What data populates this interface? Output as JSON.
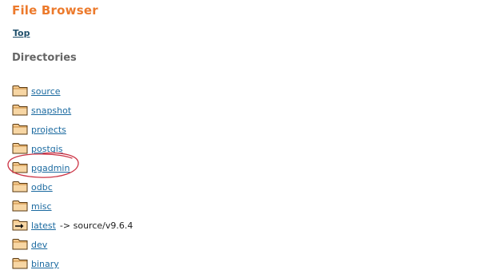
{
  "header": {
    "title": "File Browser",
    "top_link": "Top"
  },
  "directories_heading": "Directories",
  "colors": {
    "title": "#ec7a2c",
    "link": "#1b6aa0",
    "heading": "#666666",
    "annotation": "#cc3344"
  },
  "directories": [
    {
      "name": "source",
      "icon": "folder-icon"
    },
    {
      "name": "snapshot",
      "icon": "folder-icon"
    },
    {
      "name": "projects",
      "icon": "folder-icon"
    },
    {
      "name": "postgis",
      "icon": "folder-icon"
    },
    {
      "name": "pgadmin",
      "icon": "folder-icon",
      "highlighted": true
    },
    {
      "name": "odbc",
      "icon": "folder-icon"
    },
    {
      "name": "misc",
      "icon": "folder-icon"
    },
    {
      "name": "latest",
      "icon": "symlink-folder-icon",
      "target": "-> source/v9.6.4"
    },
    {
      "name": "dev",
      "icon": "folder-icon"
    },
    {
      "name": "binary",
      "icon": "folder-icon"
    }
  ]
}
